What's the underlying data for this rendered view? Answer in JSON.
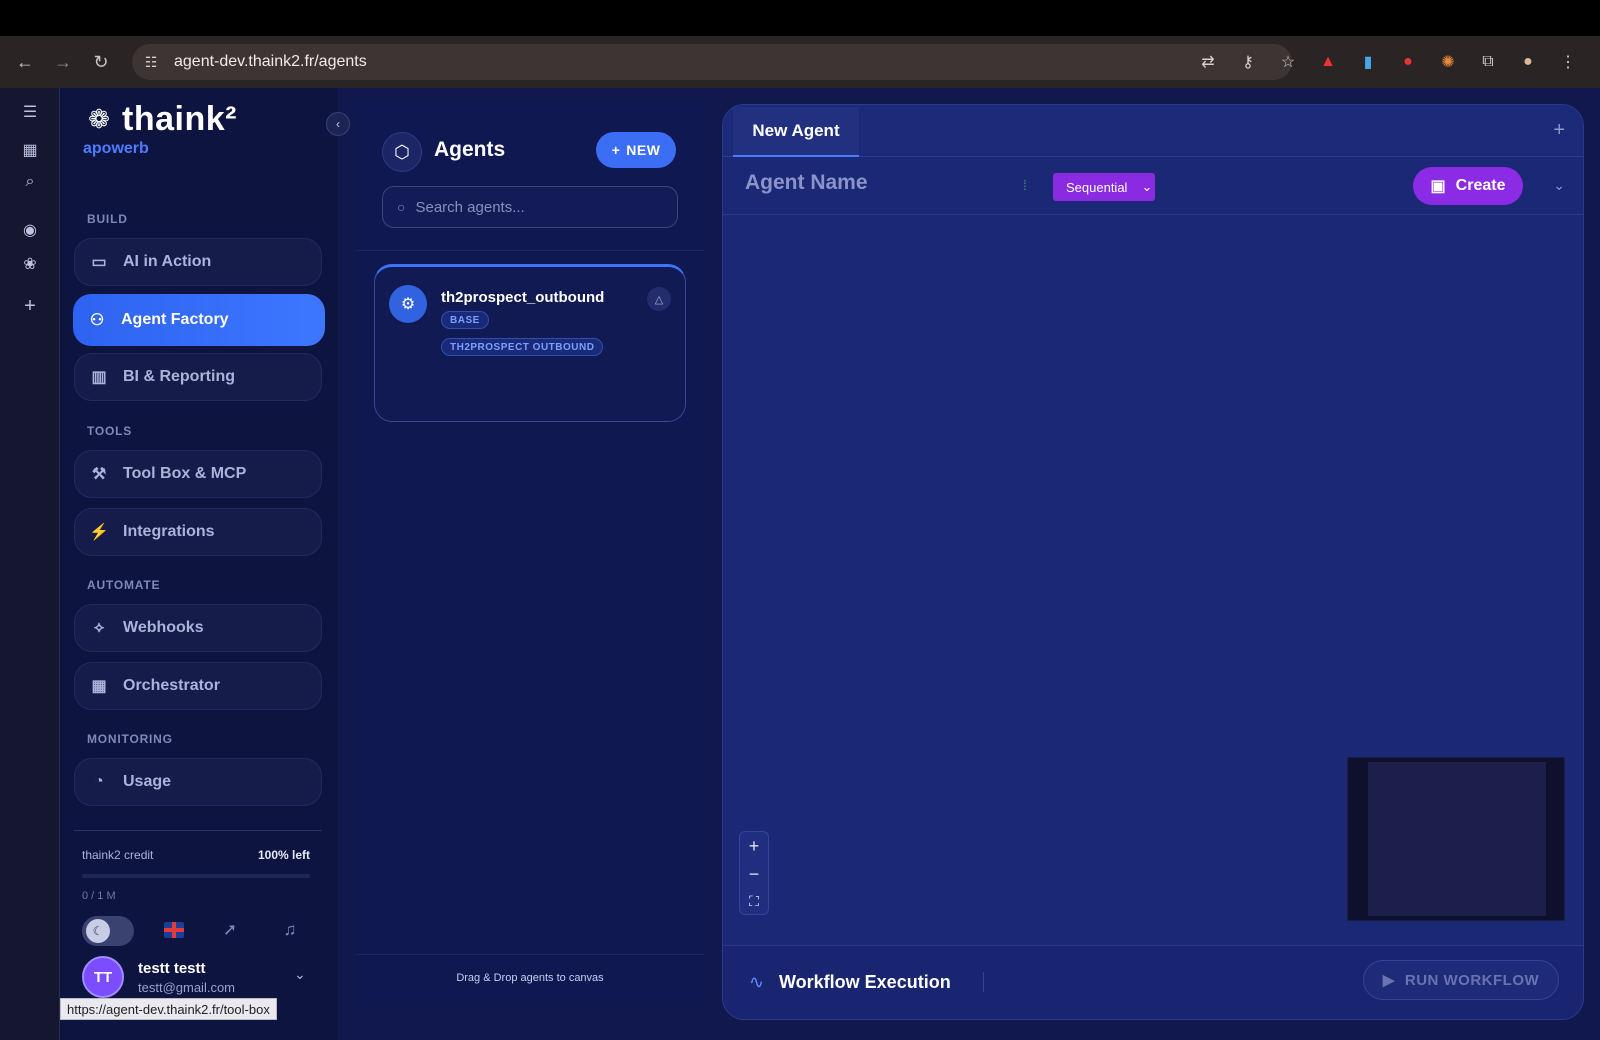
{
  "browser": {
    "url": "agent-dev.thaink2.fr/agents",
    "status_url": "https://agent-dev.thaink2.fr/tool-box"
  },
  "brand": {
    "name": "thaink²",
    "workspace": "apowerb"
  },
  "sidebar": {
    "sections": {
      "build": "BUILD",
      "tools": "TOOLS",
      "automate": "AUTOMATE",
      "monitoring": "MONITORING"
    },
    "items": [
      {
        "label": "AI in Action",
        "icon": "chat-icon"
      },
      {
        "label": "Agent Factory",
        "icon": "users-icon"
      },
      {
        "label": "BI & Reporting",
        "icon": "bar-chart-icon"
      },
      {
        "label": "Tool Box & MCP",
        "icon": "wrench-icon"
      },
      {
        "label": "Integrations",
        "icon": "plug-icon"
      },
      {
        "label": "Webhooks",
        "icon": "webhook-icon"
      },
      {
        "label": "Orchestrator",
        "icon": "calendar-icon"
      },
      {
        "label": "Usage",
        "icon": "gauge-icon"
      }
    ],
    "credit": {
      "label": "thaink2 credit",
      "left": "100% left",
      "used": "0 / 1 M",
      "used_fraction": 0
    },
    "user": {
      "initials": "TT",
      "name": "testt testt",
      "email": "testt@gmail.com"
    }
  },
  "agents_panel": {
    "title": "Agents",
    "new_label": "NEW",
    "search_placeholder": "Search agents...",
    "agents": [
      {
        "name": "th2prospect_outbound",
        "badges": [
          "BASE",
          "TH2PROSPECT OUTBOUND"
        ]
      }
    ],
    "footer": "Drag & Drop agents to canvas"
  },
  "canvas": {
    "tab": "New Agent",
    "agent_name_placeholder": "Agent Name",
    "mode": "Sequential",
    "create_label": "Create",
    "workflow_title": "Workflow Execution",
    "run_label": "RUN WORKFLOW"
  },
  "colors": {
    "accent_blue": "#3d77ff",
    "accent_purple": "#8b2be6",
    "bg": "#10184e"
  }
}
